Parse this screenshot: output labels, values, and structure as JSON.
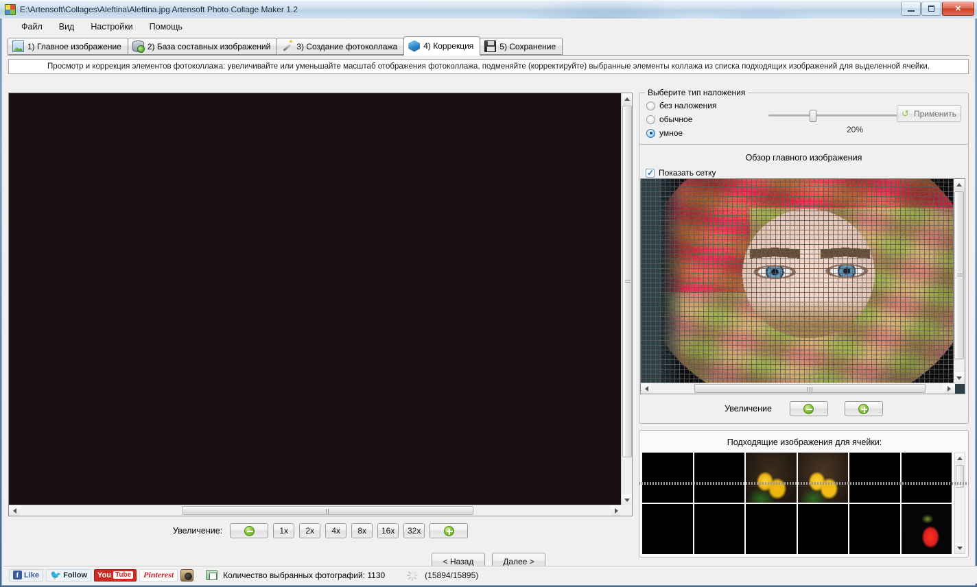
{
  "window": {
    "title": "E:\\Artensoft\\Collages\\Aleftina\\Aleftina.jpg Artensoft Photo Collage Maker 1.2",
    "app_icon": "collage-app-icon",
    "minimize_label": "",
    "maximize_label": "",
    "close_label": "✕"
  },
  "menubar": {
    "items": [
      {
        "label": "Файл",
        "name": "menu-file"
      },
      {
        "label": "Вид",
        "name": "menu-view"
      },
      {
        "label": "Настройки",
        "name": "menu-settings"
      },
      {
        "label": "Помощь",
        "name": "menu-help"
      }
    ]
  },
  "tabs": [
    {
      "label": "1) Главное изображение",
      "icon": "photo-icon",
      "active": false
    },
    {
      "label": "2) База составных изображений",
      "icon": "database-icon",
      "active": false
    },
    {
      "label": "3) Создание фотоколлажа",
      "icon": "magic-wand-icon",
      "active": false
    },
    {
      "label": "4) Коррекция",
      "icon": "cube-icon",
      "active": true
    },
    {
      "label": "5) Сохранение",
      "icon": "floppy-save-icon",
      "active": false
    }
  ],
  "hint": "Просмотр и коррекция элементов фотоколлажа: увеличивайте или уменьшайте масштаб отображения фотоколлажа, подменяйте (корректируйте) выбранные элементы коллажа из списка подходящих изображений для выделенной ячейки.",
  "zoom_toolbar": {
    "label": "Увеличение:",
    "minus_icon": "zoom-out-icon",
    "plus_icon": "zoom-in-icon",
    "levels": [
      "1x",
      "2x",
      "4x",
      "8x",
      "16x",
      "32x"
    ]
  },
  "nav": {
    "back": "< Назад",
    "next": "Далее >"
  },
  "overlay": {
    "group_title": "Выберите тип наложения",
    "options": [
      {
        "label": "без наложения",
        "selected": false
      },
      {
        "label": "обычное",
        "selected": false
      },
      {
        "label": "умное",
        "selected": true
      }
    ],
    "slider_value": "20%",
    "slider_percent": 20,
    "apply_label": "Применить",
    "apply_icon": "refresh-icon"
  },
  "overview": {
    "title": "Обзор главного изображения",
    "show_grid_label": "Показать сетку",
    "show_grid_checked": true,
    "zoom_label": "Увеличение"
  },
  "candidates": {
    "title": "Подходящие изображения для ячейки:",
    "items": [
      {
        "name": "columbine-white-pair",
        "colors": [
          "#0b0d18",
          "#e8e7ef",
          "#d8d3c2"
        ]
      },
      {
        "name": "columbine-white-trio",
        "colors": [
          "#0a0c16",
          "#eceaf0",
          "#c9c6b8"
        ]
      },
      {
        "name": "yellow-tulips-dark",
        "colors": [
          "#1d1610",
          "#e8b312",
          "#3d2d1c"
        ]
      },
      {
        "name": "yellow-tulips-pair",
        "colors": [
          "#241a12",
          "#f0bc18",
          "#4a3724"
        ]
      },
      {
        "name": "white-flower-green",
        "colors": [
          "#0d1a0f",
          "#eef4ea",
          "#2a4a22"
        ]
      },
      {
        "name": "white-trillium",
        "colors": [
          "#101a12",
          "#e8f0ec",
          "#304a2b"
        ]
      },
      {
        "name": "rosebud-branch",
        "colors": [
          "#0c1510",
          "#c0211c",
          "#d8d4c4"
        ]
      },
      {
        "name": "pink-camellia",
        "colors": [
          "#0b0b0c",
          "#e8447e",
          "#f0a02a"
        ]
      },
      {
        "name": "columbine-cluster-a",
        "colors": [
          "#060608",
          "#eeecee",
          "#d8d4bc"
        ]
      },
      {
        "name": "columbine-cluster-b",
        "colors": [
          "#050507",
          "#f0eef0",
          "#cfcbb4"
        ]
      },
      {
        "name": "red-rosebud-stem",
        "colors": [
          "#0a120c",
          "#cc1e1a",
          "#cfcab8"
        ]
      },
      {
        "name": "red-bell-flower",
        "colors": [
          "#060608",
          "#d8211c",
          "#79902e"
        ]
      }
    ]
  },
  "status": {
    "social": [
      {
        "name": "facebook-like-button",
        "label": "Like"
      },
      {
        "name": "twitter-follow-button",
        "label": "Follow"
      },
      {
        "name": "youtube-button",
        "label_a": "You",
        "label_b": "Tube"
      },
      {
        "name": "pinterest-button",
        "label": "Pinterest"
      },
      {
        "name": "instagram-button",
        "label": ""
      }
    ],
    "count_label": "Количество выбранных фотографий: 1130",
    "progress": "(15894/15895)"
  },
  "mosaic": {
    "name": "photo-mosaic-portrait",
    "cols": 43,
    "rows": 29,
    "palette_note": "woman-in-headscarf-made-of-flower-photos"
  }
}
